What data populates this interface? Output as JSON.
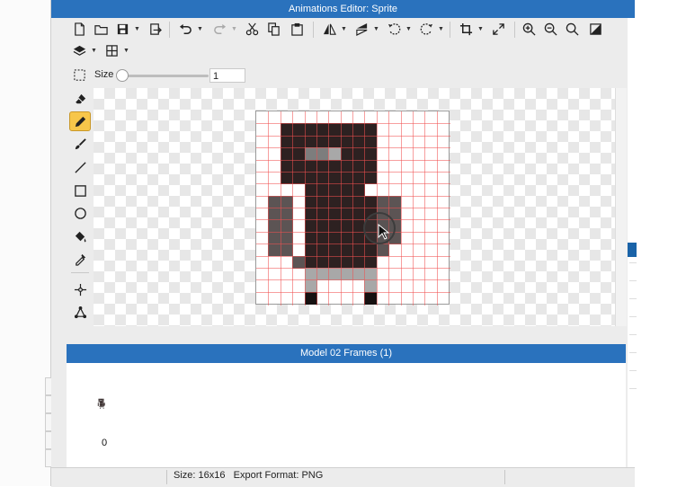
{
  "window": {
    "title": "Animations Editor: Sprite"
  },
  "toolbar": {
    "buttons": [
      "new-file-icon",
      "open-folder-icon",
      "save-icon",
      "export-icon",
      "undo-icon",
      "redo-icon",
      "cut-icon",
      "copy-icon",
      "paste-icon",
      "flip-horizontal-icon",
      "flip-vertical-icon",
      "rotate-ccw-icon",
      "rotate-cw-icon",
      "crop-icon",
      "resize-icon",
      "zoom-in-icon",
      "zoom-out-icon",
      "zoom-fit-icon",
      "contrast-icon",
      "layers-icon",
      "grid-icon"
    ]
  },
  "size_control": {
    "label": "Size",
    "value": "1",
    "slider_fraction": 0.0
  },
  "tools": [
    "eraser-icon",
    "pencil-icon",
    "brush-icon",
    "line-icon",
    "rectangle-icon",
    "ellipse-icon",
    "fill-bucket-icon",
    "eyedropper-icon",
    "move-point-icon",
    "path-icon"
  ],
  "active_tool": "pencil-icon",
  "sprite": {
    "width": 16,
    "height": 16,
    "colors": {
      "0": "",
      "1": "#2d2121",
      "2": "#5c5454",
      "3": "#7d7d7d",
      "4": "#161111",
      "5": "#a8a8a8"
    },
    "rows": [
      "0000000000000000",
      "0011111111000000",
      "0011111111000000",
      "0011335111000000",
      "0011111111000000",
      "0011111111000000",
      "0000111110000000",
      "0220111111220000",
      "0220111111220000",
      "0220111111220000",
      "0220111111220000",
      "0220111111200000",
      "0002111111000000",
      "0000555555000000",
      "0000500005000000",
      "0000400004000000"
    ]
  },
  "frames_panel": {
    "title": "Model 02 Frames (1)",
    "frame_index": "0"
  },
  "statusbar": {
    "size": "Size: 16x16",
    "format": "Export Format: PNG"
  },
  "colors": {
    "title_bar": "#2a72bd",
    "frames_header": "#2a72bd",
    "active_tool": "#f7c64a"
  }
}
